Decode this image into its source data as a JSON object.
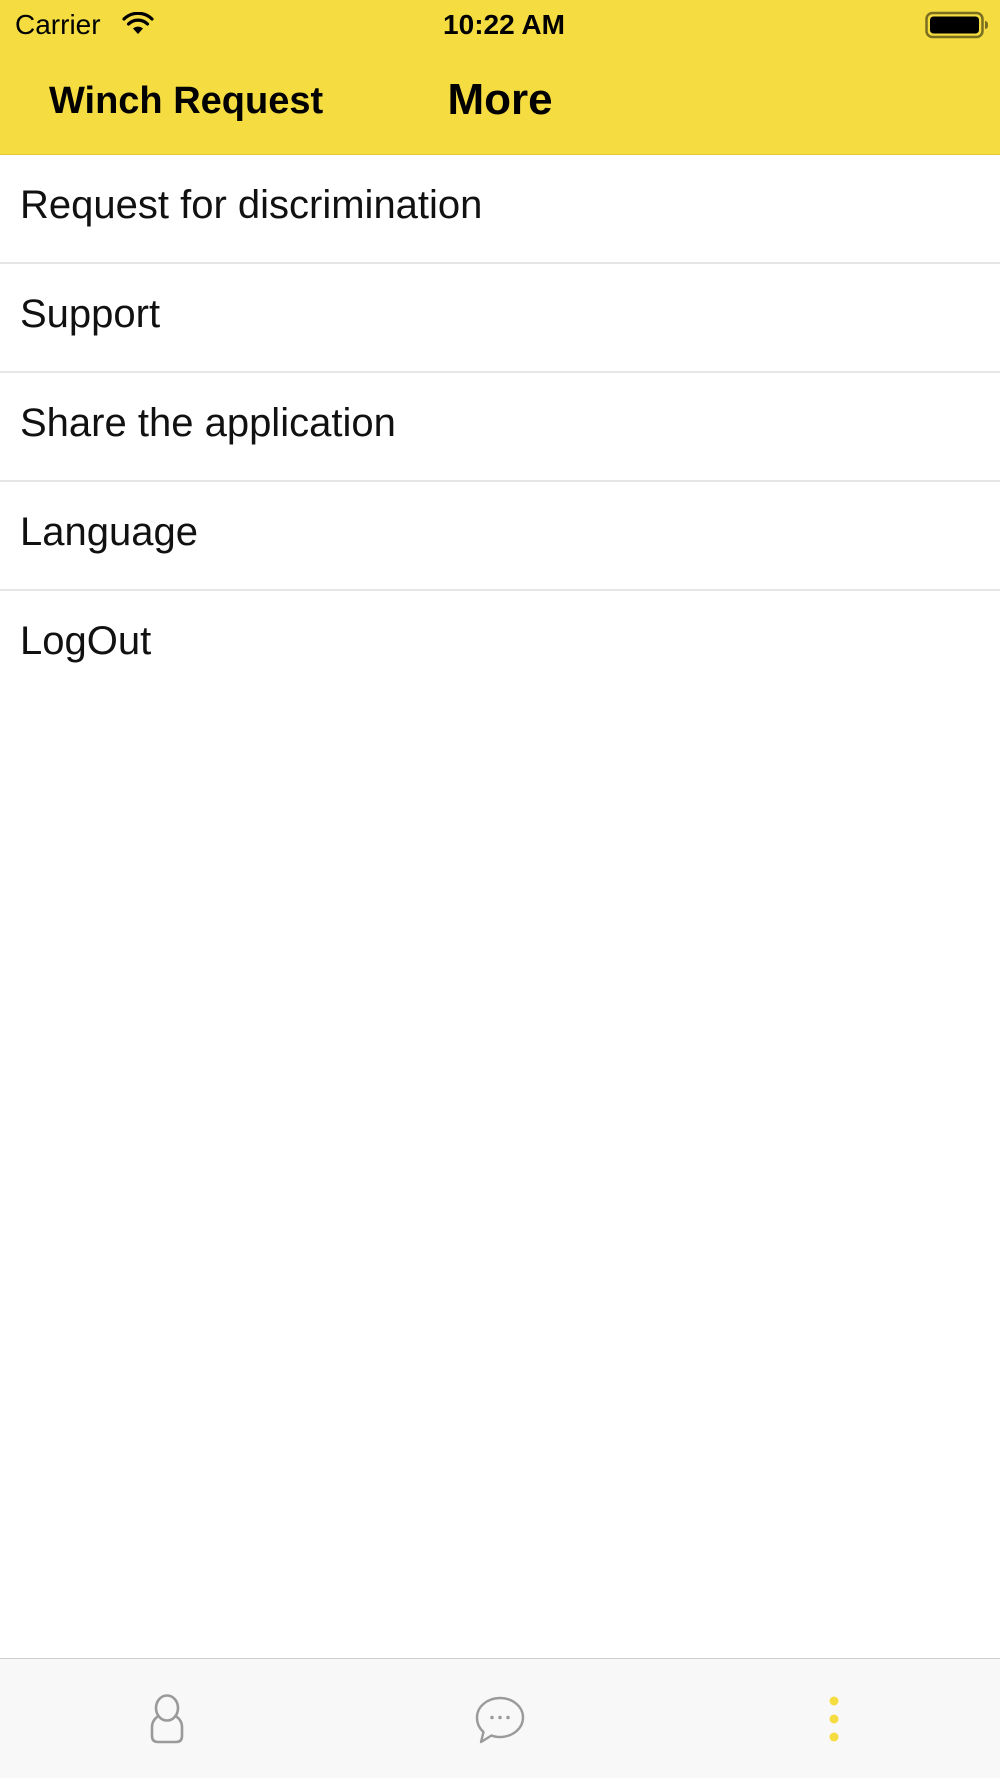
{
  "status_bar": {
    "carrier": "Carrier",
    "time": "10:22 AM",
    "wifi_icon": "wifi-icon",
    "battery_icon": "battery-full-icon"
  },
  "nav_bar": {
    "left_label": "Winch Request",
    "title": "More"
  },
  "menu": {
    "items": [
      {
        "label": "Request for discrimination"
      },
      {
        "label": "Support"
      },
      {
        "label": "Share the application"
      },
      {
        "label": "Language"
      },
      {
        "label": "LogOut"
      }
    ]
  },
  "tab_bar": {
    "tabs": [
      {
        "icon": "profile-icon",
        "active": false
      },
      {
        "icon": "chat-bubble-icon",
        "active": false
      },
      {
        "icon": "more-vertical-icon",
        "active": true
      }
    ]
  },
  "colors": {
    "header_background": "#f5dc41",
    "accent": "#f5dc41",
    "tab_inactive": "#9a9a9a",
    "divider": "#e6e6e6"
  }
}
